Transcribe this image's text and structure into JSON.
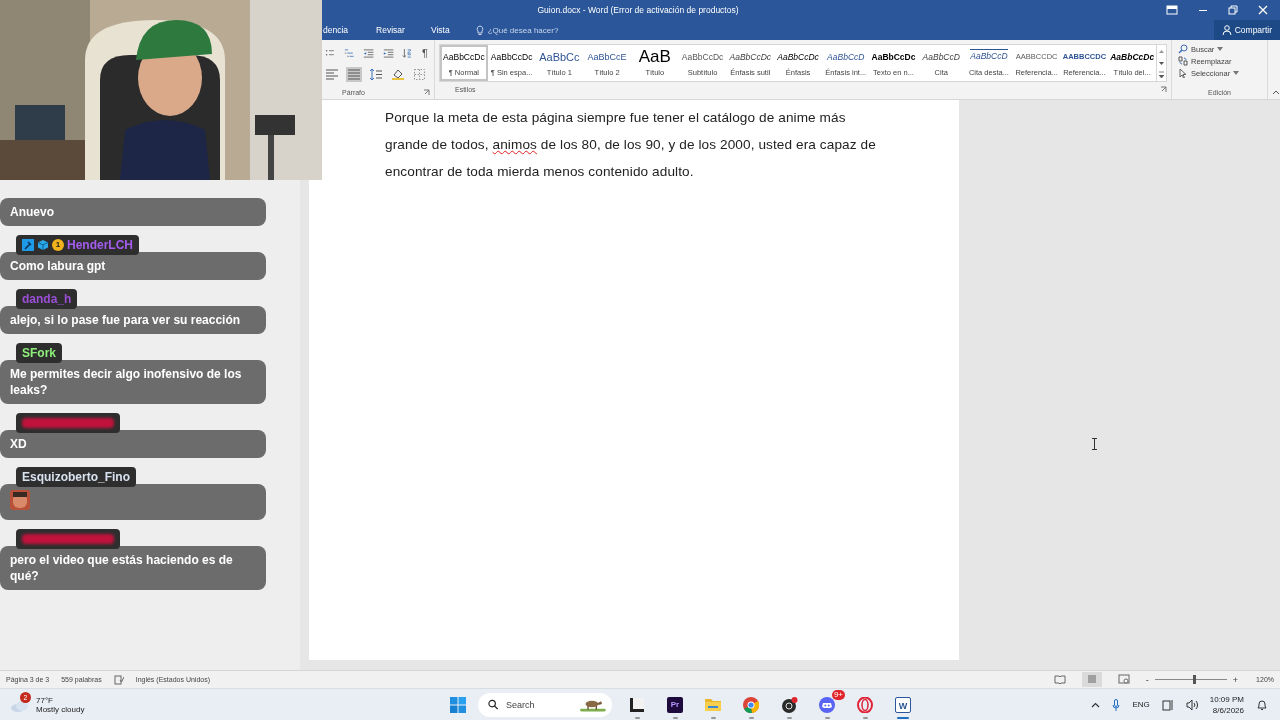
{
  "window": {
    "title": "Guion.docx - Word (Error de activación de productos)"
  },
  "tabs": [
    {
      "label": "dencia",
      "selected": false
    },
    {
      "label": "Revisar",
      "selected": false
    },
    {
      "label": "Vista",
      "selected": false
    }
  ],
  "tell_me": {
    "placeholder": "¿Qué desea hacer?"
  },
  "share_button": {
    "label": "Compartir"
  },
  "ribbon": {
    "paragraph": {
      "label": "Párrafo",
      "rows": [
        [
          {
            "kind": "bullets",
            "selected": false
          },
          {
            "kind": "multilevel",
            "selected": false
          },
          {
            "kind": "outdent",
            "selected": false
          },
          {
            "kind": "indent",
            "selected": false
          },
          {
            "kind": "sort",
            "selected": false
          },
          {
            "kind": "pilcrow",
            "text": "¶",
            "selected": false
          }
        ],
        [
          {
            "kind": "align",
            "selected": false
          },
          {
            "kind": "justify",
            "selected": true
          },
          {
            "kind": "spacing",
            "selected": false
          },
          {
            "kind": "shading",
            "selected": false
          },
          {
            "kind": "borders",
            "selected": false
          }
        ]
      ]
    },
    "styles": {
      "label": "Estilos",
      "items": [
        {
          "kind": "normal",
          "preview": "AaBbCcDc",
          "label": "¶ Normal",
          "selected": true
        },
        {
          "kind": "normal",
          "preview": "AaBbCcDc",
          "label": "¶ Sin espa...",
          "selected": false
        },
        {
          "kind": "heading1",
          "preview": "AaBbCc",
          "label": "Título 1",
          "selected": false
        },
        {
          "kind": "heading2",
          "preview": "AaBbCcE",
          "label": "Título 2",
          "selected": false
        },
        {
          "kind": "title",
          "preview": "AaB",
          "label": "Título",
          "selected": false
        },
        {
          "kind": "subtitle",
          "preview": "AaBbCcDc",
          "label": "Subtítulo",
          "selected": false
        },
        {
          "kind": "subtle",
          "preview": "AaBbCcDc",
          "label": "Énfasis sutil",
          "selected": false
        },
        {
          "kind": "emphasis",
          "preview": "AaBbCcDc",
          "label": "Énfasis",
          "selected": false
        },
        {
          "kind": "intense",
          "preview": "AaBbCcD",
          "label": "Énfasis int...",
          "selected": false
        },
        {
          "kind": "strong",
          "preview": "AaBbCcDc",
          "label": "Texto en n...",
          "selected": false
        },
        {
          "kind": "quote",
          "preview": "AaBbCcD",
          "label": "Cita",
          "selected": false
        },
        {
          "kind": "quote-intense",
          "preview": "AaBbCcD",
          "label": "Cita desta...",
          "selected": false
        },
        {
          "kind": "reference",
          "preview": "AABBCCDC",
          "label": "Referencia...",
          "selected": false
        },
        {
          "kind": "reference-intense",
          "preview": "AABBCCDC",
          "label": "Referencia...",
          "selected": false
        },
        {
          "kind": "book",
          "preview": "AaBbCcDc",
          "label": "Título del...",
          "selected": false
        }
      ]
    },
    "editing": {
      "label": "Edición",
      "items": [
        {
          "kind": "find",
          "label": "Buscar",
          "dropdown": true
        },
        {
          "kind": "replace",
          "label": "Reemplazar",
          "dropdown": false
        },
        {
          "kind": "select",
          "label": "Seleccionar",
          "dropdown": true
        }
      ]
    }
  },
  "document": {
    "paragraph": [
      {
        "kind": "text",
        "text": "Porque la meta de esta página siempre fue tener el catálogo de anime más grande de todos, "
      },
      {
        "kind": "misspelled",
        "text": "animos"
      },
      {
        "kind": "text",
        "text": " de los 80, de los 90, y de los 2000, usted era capaz de encontrar de toda mierda menos contenido adulto."
      }
    ]
  },
  "status_bar": {
    "page": "Página 3 de 3",
    "words": "559 palabras",
    "language": "Inglés (Estados Unidos)",
    "views": [
      {
        "kind": "read",
        "selected": false
      },
      {
        "kind": "print",
        "selected": true
      },
      {
        "kind": "web",
        "selected": false
      }
    ],
    "zoom": {
      "minus": "-",
      "plus": "+",
      "level": 0.55,
      "reading": "120%"
    }
  },
  "chat": [
    {
      "redacted": false,
      "text": "Anuevo"
    },
    {
      "redacted": false,
      "name": "HenderLCH",
      "color": "#a45cf0",
      "badges": [
        {
          "kind": "tool"
        },
        {
          "kind": "cube"
        },
        {
          "kind": "coin",
          "text": "1"
        }
      ],
      "text": "Como labura gpt"
    },
    {
      "redacted": false,
      "name": "danda_h",
      "color": "#9b4fd6",
      "text": "alejo, si lo pase fue para ver su reacción"
    },
    {
      "redacted": false,
      "name": "SFork",
      "color": "#8ef07a",
      "text": "Me permites decir algo inofensivo de los leaks?"
    },
    {
      "redacted": true,
      "color": "#c0123c",
      "text": "XD"
    },
    {
      "redacted": false,
      "name": "Esquizoberto_Fino",
      "color": "#d8e2ee",
      "emote": true
    },
    {
      "redacted": true,
      "color": "#c0123c",
      "text": "pero el video que estás haciendo es de qué?"
    }
  ],
  "taskbar": {
    "weather": {
      "temp": "77°F",
      "condition": "Mostly cloudy",
      "badge": "2"
    },
    "search": {
      "placeholder": "Search"
    },
    "apps": [
      {
        "kind": "files",
        "active": false
      },
      {
        "kind": "premiere",
        "text": "Pr",
        "active": false
      },
      {
        "kind": "folder",
        "active": false
      },
      {
        "kind": "chrome",
        "active": false
      },
      {
        "kind": "obs",
        "active": false
      },
      {
        "kind": "discord",
        "badge": "9+",
        "active": false
      },
      {
        "kind": "opera",
        "active": false
      },
      {
        "kind": "word",
        "text": "W",
        "active": true
      }
    ],
    "tray": {
      "language": "ENG",
      "time": "10:09 PM",
      "date": "8/6/2026"
    }
  }
}
